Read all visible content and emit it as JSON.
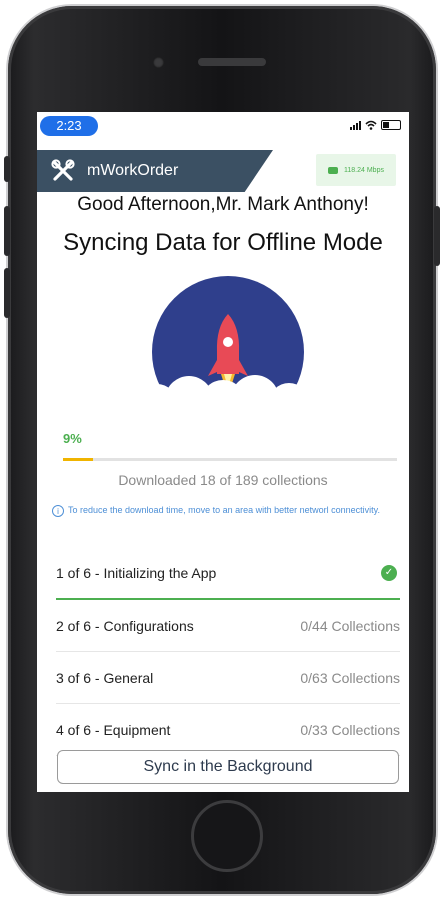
{
  "status_bar": {
    "time": "2:23"
  },
  "app_bar": {
    "app_name": "mWorkOrder",
    "network_speed": "118.24 Mbps"
  },
  "greeting": "Good Afternoon,Mr. Mark Anthony!",
  "sync_title": "Syncing Data for Offline Mode",
  "progress": {
    "percent_label": "9%",
    "value": 0.09,
    "downloaded_text": "Downloaded 18 of 189 collections"
  },
  "info_text": "To reduce the download time, move to an area with better networl connectivity.",
  "steps": [
    {
      "label": "1 of 6 - Initializing the App",
      "count": "",
      "done": true
    },
    {
      "label": "2 of 6 - Configurations",
      "count": "0/44 Collections"
    },
    {
      "label": "3 of 6 - General",
      "count": "0/63 Collections"
    },
    {
      "label": "4 of 6 - Equipment",
      "count": "0/33 Collections"
    }
  ],
  "sync_background_label": "Sync in the Background",
  "colors": {
    "header": "#3b5063",
    "success": "#4caf50",
    "progress": "#f0b400",
    "illustration_circle": "#2f3f8c",
    "rocket": "#e84a56"
  },
  "icons": {
    "app": "tools-icon",
    "speed": "network-icon",
    "info": "info-icon",
    "done": "check-circle-icon"
  }
}
